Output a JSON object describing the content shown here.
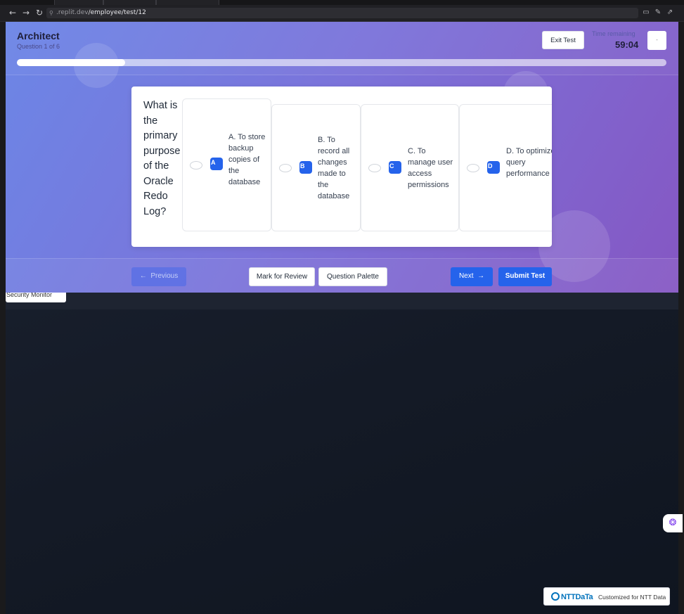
{
  "browser": {
    "url_host": ".replit.dev",
    "url_path": "/employee/test/12"
  },
  "header": {
    "title": "Architect",
    "question_counter": "Question 1 of 6",
    "exit_label": "Exit Test",
    "time_label": "Time remaining",
    "time_value": "59:04",
    "menu_label": "-",
    "progress_fraction": 0.1667
  },
  "question": {
    "text": "What is the primary purpose of the Oracle Redo Log?",
    "options": [
      {
        "letter": "A",
        "text": "A. To store backup copies of the database"
      },
      {
        "letter": "B",
        "text": "B. To record all changes made to the database"
      },
      {
        "letter": "C",
        "text": "C. To manage user access permissions"
      },
      {
        "letter": "D",
        "text": "D. To optimize query performance"
      }
    ]
  },
  "footer": {
    "previous_label": "Previous",
    "review_label": "Mark for Review",
    "palette_label": "Question Palette",
    "next_label": "Next",
    "submit_label": "Submit Test"
  },
  "overlay": {
    "security_monitor_label": "Security Monitor",
    "brand_logo": "NTTDaTa",
    "brand_text": "Customized for NTT Data"
  },
  "colors": {
    "primary": "#2563eb",
    "gradient_start": "#6c86e6",
    "gradient_end": "#8557c3",
    "ntt_blue": "#0072bc"
  },
  "icons": [
    "back-arrow-icon",
    "forward-arrow-icon",
    "reload-icon",
    "link-icon",
    "arrow-left-icon",
    "arrow-right-icon",
    "brain-icon"
  ]
}
